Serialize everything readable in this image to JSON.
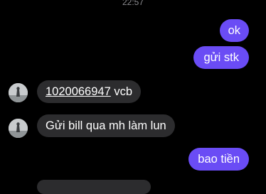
{
  "timestamp": "22:57",
  "messages": [
    {
      "side": "outgoing",
      "text": "ok"
    },
    {
      "side": "outgoing",
      "text": "gửi stk"
    },
    {
      "side": "incoming",
      "link": "1020066947",
      "text": " vcb"
    },
    {
      "side": "incoming",
      "text": "Gửi bill qua mh làm lun"
    },
    {
      "side": "outgoing",
      "text": "bao tiền"
    }
  ],
  "colors": {
    "background": "#000000",
    "outgoing_bubble": "#6a4cf5",
    "incoming_bubble": "#2c2c2e",
    "text": "#ffffff",
    "timestamp": "#8a8a8e"
  }
}
